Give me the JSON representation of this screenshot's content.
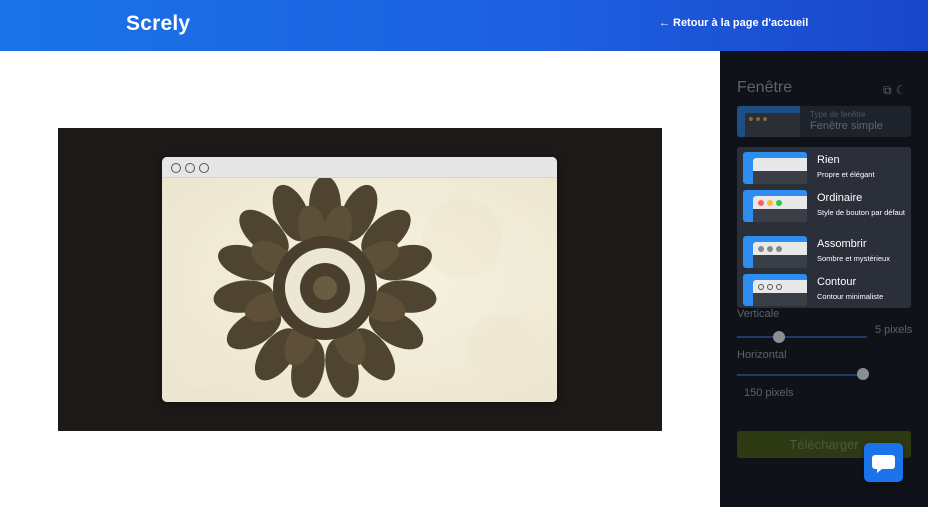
{
  "header": {
    "logo": "Screly",
    "back_link": "Retour à la page d'accueil"
  },
  "sidebar": {
    "title": "Fenêtre",
    "icons": [
      "copy-icon",
      "moon-icon"
    ],
    "window_type": {
      "label": "Type de fenêtre",
      "value": "Fenêtre simple"
    },
    "options": [
      {
        "title": "Rien",
        "desc": "Propre et élégant",
        "style": "none"
      },
      {
        "title": "Ordinaire",
        "desc": "Style de bouton par défaut",
        "style": "color"
      },
      {
        "title": "Assombrir",
        "desc": "Sombre et mystérieux",
        "style": "dark"
      },
      {
        "title": "Contour",
        "desc": "Contour minimaliste",
        "style": "outline"
      }
    ],
    "vertical": {
      "label": "Verticale",
      "value": "5 pixels",
      "fraction": 0.32
    },
    "horizontal": {
      "label": "Horizontal",
      "value": "150 pixels",
      "fraction": 0.97
    },
    "download": "Télécharger"
  },
  "colors": {
    "header_start": "#1a73e8",
    "header_end": "#1a46c9",
    "sidebar_bg": "#0f1319",
    "backdrop": "#1c1918",
    "accent": "#2d8ef0"
  }
}
